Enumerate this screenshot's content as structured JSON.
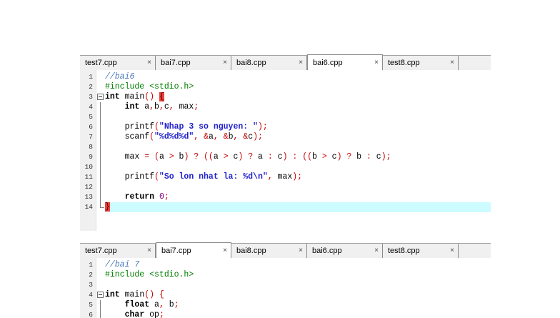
{
  "colors": {
    "comment": "#4878B8",
    "preprocessor": "#008000",
    "keyword": "#000000",
    "string": "#2222CC",
    "operator": "#CC0000",
    "number": "#800080",
    "plain": "#000000",
    "tabbar_bg": "#F0F0F0",
    "tab_active_bg": "#FFFFFF",
    "gutter_bg": "#F0F0F0",
    "line_highlight": "#CCFCFF",
    "brace_highlight_bg": "#E8403A",
    "brace_highlight_fg": "#5A0000"
  },
  "close_glyph": "×",
  "panels": [
    {
      "name": "top-editor",
      "tabs": [
        {
          "label": "test7.cpp",
          "active": false
        },
        {
          "label": "bai7.cpp",
          "active": false
        },
        {
          "label": "bai8.cpp",
          "active": false
        },
        {
          "label": "bai6.cpp",
          "active": true
        },
        {
          "label": "test8.cpp",
          "active": false
        }
      ],
      "lines": [
        {
          "n": "1",
          "fold": "",
          "seg": [
            [
              "comment",
              "//bai6"
            ]
          ]
        },
        {
          "n": "2",
          "fold": "",
          "seg": [
            [
              "pre",
              "#include <stdio.h>"
            ]
          ]
        },
        {
          "n": "3",
          "fold": "start",
          "seg": [
            [
              "kw",
              "int"
            ],
            [
              "plain",
              " main"
            ],
            [
              "op",
              "()"
            ],
            [
              "plain",
              " "
            ],
            [
              "bracehl",
              "{"
            ]
          ]
        },
        {
          "n": "4",
          "fold": "mid",
          "seg": [
            [
              "plain",
              "    "
            ],
            [
              "kw",
              "int"
            ],
            [
              "plain",
              " a"
            ],
            [
              "op",
              ","
            ],
            [
              "plain",
              "b"
            ],
            [
              "op",
              ","
            ],
            [
              "plain",
              "c"
            ],
            [
              "op",
              ","
            ],
            [
              "plain",
              " max"
            ],
            [
              "op",
              ";"
            ]
          ]
        },
        {
          "n": "5",
          "fold": "mid",
          "seg": []
        },
        {
          "n": "6",
          "fold": "mid",
          "seg": [
            [
              "plain",
              "    printf"
            ],
            [
              "op",
              "("
            ],
            [
              "str",
              "\"Nhap 3 so nguyen: \""
            ],
            [
              "op",
              ");"
            ]
          ]
        },
        {
          "n": "7",
          "fold": "mid",
          "seg": [
            [
              "plain",
              "    scanf"
            ],
            [
              "op",
              "("
            ],
            [
              "str",
              "\"%d%d%d\""
            ],
            [
              "op",
              ","
            ],
            [
              "plain",
              " "
            ],
            [
              "op",
              "&"
            ],
            [
              "plain",
              "a"
            ],
            [
              "op",
              ","
            ],
            [
              "plain",
              " "
            ],
            [
              "op",
              "&"
            ],
            [
              "plain",
              "b"
            ],
            [
              "op",
              ","
            ],
            [
              "plain",
              " "
            ],
            [
              "op",
              "&"
            ],
            [
              "plain",
              "c"
            ],
            [
              "op",
              ");"
            ]
          ]
        },
        {
          "n": "8",
          "fold": "mid",
          "seg": []
        },
        {
          "n": "9",
          "fold": "mid",
          "seg": [
            [
              "plain",
              "    max "
            ],
            [
              "op",
              "="
            ],
            [
              "plain",
              " "
            ],
            [
              "op",
              "("
            ],
            [
              "plain",
              "a "
            ],
            [
              "op",
              ">"
            ],
            [
              "plain",
              " b"
            ],
            [
              "op",
              ")"
            ],
            [
              "plain",
              " "
            ],
            [
              "op",
              "?"
            ],
            [
              "plain",
              " "
            ],
            [
              "op",
              "(("
            ],
            [
              "plain",
              "a "
            ],
            [
              "op",
              ">"
            ],
            [
              "plain",
              " c"
            ],
            [
              "op",
              ")"
            ],
            [
              "plain",
              " "
            ],
            [
              "op",
              "?"
            ],
            [
              "plain",
              " a "
            ],
            [
              "op",
              ":"
            ],
            [
              "plain",
              " c"
            ],
            [
              "op",
              ")"
            ],
            [
              "plain",
              " "
            ],
            [
              "op",
              ":"
            ],
            [
              "plain",
              " "
            ],
            [
              "op",
              "(("
            ],
            [
              "plain",
              "b "
            ],
            [
              "op",
              ">"
            ],
            [
              "plain",
              " c"
            ],
            [
              "op",
              ")"
            ],
            [
              "plain",
              " "
            ],
            [
              "op",
              "?"
            ],
            [
              "plain",
              " b "
            ],
            [
              "op",
              ":"
            ],
            [
              "plain",
              " c"
            ],
            [
              "op",
              ");"
            ]
          ]
        },
        {
          "n": "10",
          "fold": "mid",
          "seg": []
        },
        {
          "n": "11",
          "fold": "mid",
          "seg": [
            [
              "plain",
              "    printf"
            ],
            [
              "op",
              "("
            ],
            [
              "str",
              "\"So lon nhat la: %d\\n\""
            ],
            [
              "op",
              ","
            ],
            [
              "plain",
              " max"
            ],
            [
              "op",
              ");"
            ]
          ]
        },
        {
          "n": "12",
          "fold": "mid",
          "seg": []
        },
        {
          "n": "13",
          "fold": "mid",
          "seg": [
            [
              "plain",
              "    "
            ],
            [
              "kw",
              "return"
            ],
            [
              "plain",
              " "
            ],
            [
              "num",
              "0"
            ],
            [
              "op",
              ";"
            ]
          ]
        },
        {
          "n": "14",
          "fold": "end",
          "seg": [
            [
              "bracehl",
              "}"
            ]
          ],
          "highlight": true
        }
      ]
    },
    {
      "name": "bottom-editor",
      "tabs": [
        {
          "label": "test7.cpp",
          "active": false
        },
        {
          "label": "bai7.cpp",
          "active": true
        },
        {
          "label": "bai8.cpp",
          "active": false
        },
        {
          "label": "bai6.cpp",
          "active": false
        },
        {
          "label": "test8.cpp",
          "active": false
        }
      ],
      "lines": [
        {
          "n": "1",
          "fold": "",
          "seg": [
            [
              "comment",
              "//bai 7"
            ]
          ]
        },
        {
          "n": "2",
          "fold": "",
          "seg": [
            [
              "pre",
              "#include <stdio.h>"
            ]
          ]
        },
        {
          "n": "3",
          "fold": "",
          "seg": []
        },
        {
          "n": "4",
          "fold": "start",
          "seg": [
            [
              "kw",
              "int"
            ],
            [
              "plain",
              " main"
            ],
            [
              "op",
              "()"
            ],
            [
              "plain",
              " "
            ],
            [
              "op",
              "{"
            ]
          ]
        },
        {
          "n": "5",
          "fold": "mid",
          "seg": [
            [
              "plain",
              "    "
            ],
            [
              "kw",
              "float"
            ],
            [
              "plain",
              " a"
            ],
            [
              "op",
              ","
            ],
            [
              "plain",
              " b"
            ],
            [
              "op",
              ";"
            ]
          ]
        },
        {
          "n": "6",
          "fold": "mid",
          "seg": [
            [
              "plain",
              "    "
            ],
            [
              "kw",
              "char"
            ],
            [
              "plain",
              " op"
            ],
            [
              "op",
              ";"
            ]
          ]
        }
      ]
    }
  ]
}
